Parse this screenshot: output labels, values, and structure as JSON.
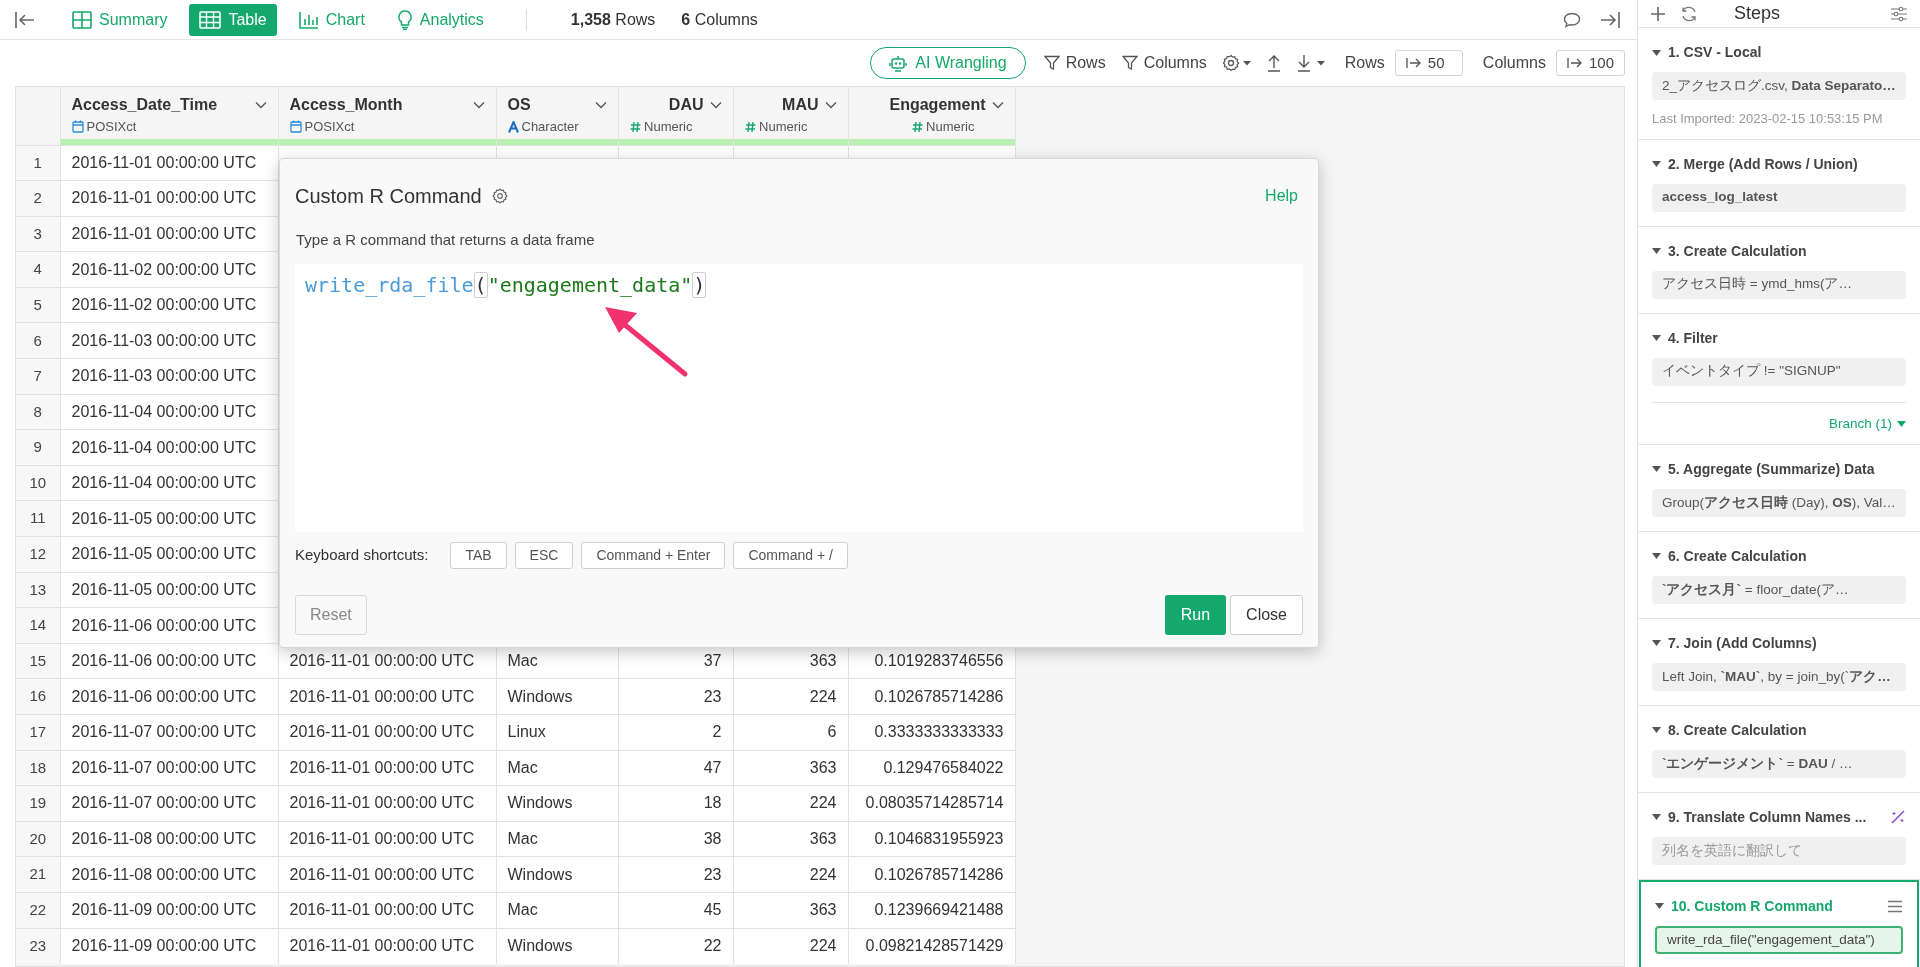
{
  "tabs": [
    {
      "label": "Summary",
      "kind": "summary",
      "selected": false
    },
    {
      "label": "Table",
      "kind": "table",
      "selected": true
    },
    {
      "label": "Chart",
      "kind": "chart",
      "selected": false
    },
    {
      "label": "Analytics",
      "kind": "analytics",
      "selected": false
    }
  ],
  "counts": [
    "**1,358** Rows",
    "**6** Columns"
  ],
  "toolbar": {
    "ai_button": "AI Wrangling",
    "rows_filter": "Rows",
    "columns_filter": "Columns",
    "rows_label": "Rows",
    "rows_value": "50",
    "columns_label": "Columns",
    "columns_value": "100"
  },
  "columns": [
    {
      "name": "Access_Date_Time",
      "type": "POSIXct",
      "kind": "datetime"
    },
    {
      "name": "Access_Month",
      "type": "POSIXct",
      "kind": "datetime"
    },
    {
      "name": "OS",
      "type": "Character",
      "kind": "character"
    },
    {
      "name": "DAU",
      "type": "Numeric",
      "kind": "numeric"
    },
    {
      "name": "MAU",
      "type": "Numeric",
      "kind": "numeric"
    },
    {
      "name": "Engagement",
      "type": "Numeric",
      "kind": "numeric"
    }
  ],
  "rows": [
    {
      "number": "1",
      "cells": [
        "2016-11-01 00:00:00 UTC"
      ]
    },
    {
      "number": "2",
      "cells": [
        "2016-11-01 00:00:00 UTC"
      ]
    },
    {
      "number": "3",
      "cells": [
        "2016-11-01 00:00:00 UTC"
      ]
    },
    {
      "number": "4",
      "cells": [
        "2016-11-02 00:00:00 UTC"
      ]
    },
    {
      "number": "5",
      "cells": [
        "2016-11-02 00:00:00 UTC"
      ]
    },
    {
      "number": "6",
      "cells": [
        "2016-11-03 00:00:00 UTC"
      ]
    },
    {
      "number": "7",
      "cells": [
        "2016-11-03 00:00:00 UTC"
      ]
    },
    {
      "number": "8",
      "cells": [
        "2016-11-04 00:00:00 UTC"
      ]
    },
    {
      "number": "9",
      "cells": [
        "2016-11-04 00:00:00 UTC"
      ]
    },
    {
      "number": "10",
      "cells": [
        "2016-11-04 00:00:00 UTC"
      ]
    },
    {
      "number": "11",
      "cells": [
        "2016-11-05 00:00:00 UTC"
      ]
    },
    {
      "number": "12",
      "cells": [
        "2016-11-05 00:00:00 UTC"
      ]
    },
    {
      "number": "13",
      "cells": [
        "2016-11-05 00:00:00 UTC"
      ]
    },
    {
      "number": "14",
      "cells": [
        "2016-11-06 00:00:00 UTC"
      ]
    },
    {
      "number": "15",
      "cells": [
        "2016-11-06 00:00:00 UTC",
        "2016-11-01 00:00:00 UTC",
        "Mac",
        "37",
        "363",
        "0.1019283746556"
      ]
    },
    {
      "number": "16",
      "cells": [
        "2016-11-06 00:00:00 UTC",
        "2016-11-01 00:00:00 UTC",
        "Windows",
        "23",
        "224",
        "0.1026785714286"
      ]
    },
    {
      "number": "17",
      "cells": [
        "2016-11-07 00:00:00 UTC",
        "2016-11-01 00:00:00 UTC",
        "Linux",
        "2",
        "6",
        "0.3333333333333"
      ]
    },
    {
      "number": "18",
      "cells": [
        "2016-11-07 00:00:00 UTC",
        "2016-11-01 00:00:00 UTC",
        "Mac",
        "47",
        "363",
        "0.129476584022"
      ]
    },
    {
      "number": "19",
      "cells": [
        "2016-11-07 00:00:00 UTC",
        "2016-11-01 00:00:00 UTC",
        "Windows",
        "18",
        "224",
        "0.08035714285714"
      ]
    },
    {
      "number": "20",
      "cells": [
        "2016-11-08 00:00:00 UTC",
        "2016-11-01 00:00:00 UTC",
        "Mac",
        "38",
        "363",
        "0.1046831955923"
      ]
    },
    {
      "number": "21",
      "cells": [
        "2016-11-08 00:00:00 UTC",
        "2016-11-01 00:00:00 UTC",
        "Windows",
        "23",
        "224",
        "0.1026785714286"
      ]
    },
    {
      "number": "22",
      "cells": [
        "2016-11-09 00:00:00 UTC",
        "2016-11-01 00:00:00 UTC",
        "Mac",
        "45",
        "363",
        "0.1239669421488"
      ]
    },
    {
      "number": "23",
      "cells": [
        "2016-11-09 00:00:00 UTC",
        "2016-11-01 00:00:00 UTC",
        "Windows",
        "22",
        "224",
        "0.09821428571429"
      ]
    }
  ],
  "dialog": {
    "title": "Custom R Command",
    "help": "Help",
    "instruction": "Type a R command that returns a data frame",
    "code": [
      {
        "kind": "function",
        "text": "write_rda_file"
      },
      {
        "kind": "paren",
        "text": "("
      },
      {
        "kind": "string",
        "text": "\"engagement_data\""
      },
      {
        "kind": "paren",
        "text": ")"
      }
    ],
    "shortcuts_label": "Keyboard shortcuts:",
    "shortcuts": [
      "TAB",
      "ESC",
      "Command + Enter",
      "Command + /"
    ],
    "reset": "Reset",
    "run": "Run",
    "close": "Close"
  },
  "steps_panel": {
    "title": "Steps",
    "steps": [
      {
        "title": "1. CSV - Local",
        "kind": "standard",
        "expanded": true,
        "selected": false,
        "summary": "2_アクセスログ.csv, **Data Separato…**",
        "bold": false,
        "muted": false,
        "note": "Last Imported: 2023-02-15 10:53:15 PM"
      },
      {
        "title": "2. Merge (Add Rows / Union)",
        "kind": "standard",
        "expanded": true,
        "selected": false,
        "summary": "access_log_latest",
        "bold": true,
        "muted": false
      },
      {
        "title": "3. Create Calculation",
        "kind": "standard",
        "expanded": true,
        "selected": false,
        "summary": "アクセス日時 = ymd_hms(ア…",
        "bold": false,
        "muted": false
      },
      {
        "title": "4. Filter",
        "kind": "standard",
        "expanded": true,
        "selected": false,
        "summary": "イベントタイプ != \"SIGNUP\"",
        "bold": false,
        "muted": false,
        "branch": "Branch (1)"
      },
      {
        "title": "5. Aggregate (Summarize) Data",
        "kind": "standard",
        "expanded": true,
        "selected": false,
        "summary": "Group(**アクセス日時** (Day), **OS**), Val…",
        "bold": false,
        "muted": false
      },
      {
        "title": "6. Create Calculation",
        "kind": "standard",
        "expanded": true,
        "selected": false,
        "summary": "**`アクセス月`** = floor_date(ア…",
        "bold": false,
        "muted": false
      },
      {
        "title": "7. Join (Add Columns)",
        "kind": "standard",
        "expanded": true,
        "selected": false,
        "summary": "Left Join, **`MAU`**, by = join_by(`**アク…**",
        "bold": false,
        "muted": false
      },
      {
        "title": "8. Create Calculation",
        "kind": "standard",
        "expanded": true,
        "selected": false,
        "summary": "**`エンゲージメント`** = **DAU** / …",
        "bold": false,
        "muted": false
      },
      {
        "title": "9. Translate Column Names ...",
        "kind": "ai",
        "expanded": true,
        "selected": false,
        "summary": "列名を英語に翻訳して",
        "bold": false,
        "muted": true
      },
      {
        "title": "10. Custom R Command",
        "kind": "standard",
        "expanded": true,
        "selected": true,
        "summary": "write_rda_file(\"engagement_data\")",
        "bold": false,
        "muted": false
      }
    ]
  }
}
